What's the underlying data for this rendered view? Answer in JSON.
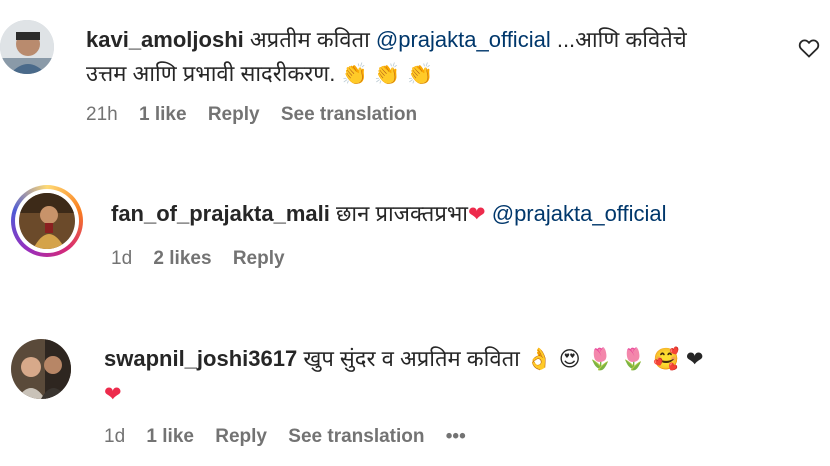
{
  "comments": [
    {
      "username": "kavi_amoljoshi",
      "text_line1": "अप्रतीम कविता",
      "mention": "@prajakta_official",
      "text_line1b": "...आणि कवितेचे",
      "text_line2": "उत्तम आणि प्रभावी सादरीकरण.",
      "emoji": "👏 👏 👏",
      "time": "21h",
      "likes": "1 like",
      "reply": "Reply",
      "translation": "See translation"
    },
    {
      "username": "fan_of_prajakta_mali",
      "text_line1": "छान प्राजक्तप्रभा",
      "emoji": "❤",
      "mention": "@prajakta_official",
      "time": "1d",
      "likes": "2 likes",
      "reply": "Reply"
    },
    {
      "username": "swapnil_joshi3617",
      "text_line1": "खुप सुंदर व अप्रतिम कविता",
      "emoji": "👌 😍 🌷 🌷 🥰 ❤",
      "emoji_line2": "❤",
      "time": "1d",
      "likes": "1 like",
      "reply": "Reply",
      "translation": "See translation",
      "more": "•••"
    }
  ],
  "colors": {
    "mention": "#00376b",
    "meta": "#737373",
    "heart": "#ed2b4c",
    "story_ring": "#dd2a7b"
  },
  "icons": [
    "heart-outline-icon"
  ]
}
